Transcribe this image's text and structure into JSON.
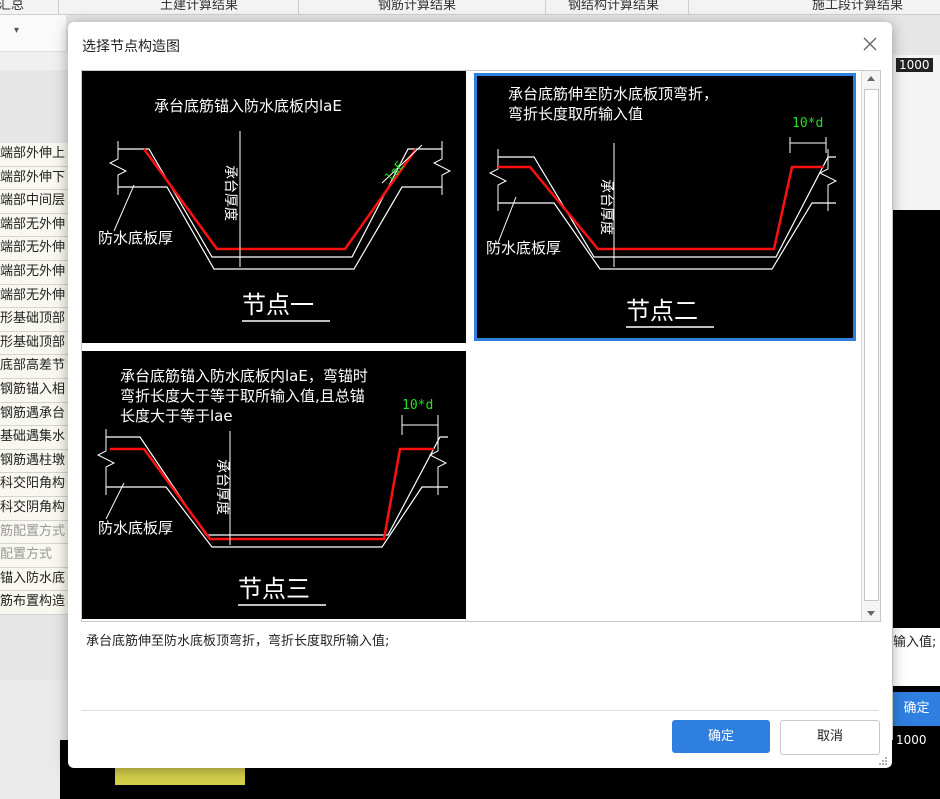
{
  "background": {
    "tabs": [
      "汇总",
      "土建计算结果",
      "钢筋计算结果",
      "钢结构计算结果",
      "施工段计算结果"
    ],
    "list_items": [
      "端部外伸上",
      "端部外伸下",
      "端部中间层",
      "端部无外伸",
      "端部无外伸",
      "端部无外伸",
      "端部无外伸",
      "形基础顶部",
      "形基础顶部",
      "底部高差节",
      "钢筋锚入相",
      "钢筋遇承台",
      "基础遇集水",
      "钢筋遇柱墩",
      "科交阳角构",
      "科交阴角构",
      "筋配置方式",
      "配置方式",
      "锚入防水底",
      "筋布置构造"
    ],
    "right_number_top": "1000",
    "right_text": "输入值;",
    "right_button": "确定",
    "right_number_bottom": "1000"
  },
  "dialog": {
    "title": "选择节点构造图",
    "description": "承台底筋伸至防水底板顶弯折，弯折长度取所输入值;",
    "ok_label": "确定",
    "cancel_label": "取消",
    "options": [
      {
        "id": "node1",
        "caption_lines": [
          "承台底筋锚入防水底板内laE"
        ],
        "dim_label": "laE",
        "thickness_label": "承台厚度",
        "slab_label": "防水底板厚",
        "node_label": "节点一",
        "selected": false
      },
      {
        "id": "node2",
        "caption_lines": [
          "承台底筋伸至防水底板顶弯折，",
          "弯折长度取所输入值"
        ],
        "dim_label": "10*d",
        "thickness_label": "承台厚度",
        "slab_label": "防水底板厚",
        "node_label": "节点二",
        "selected": true
      },
      {
        "id": "node3",
        "caption_lines": [
          "承台底筋锚入防水底板内laE，弯锚时",
          "弯折长度大于等于取所输入值,且总锚",
          "长度大于等于lae"
        ],
        "dim_label": "10*d",
        "thickness_label": "承台厚度",
        "slab_label": "防水底板厚",
        "node_label": "节点三",
        "selected": false
      }
    ]
  }
}
